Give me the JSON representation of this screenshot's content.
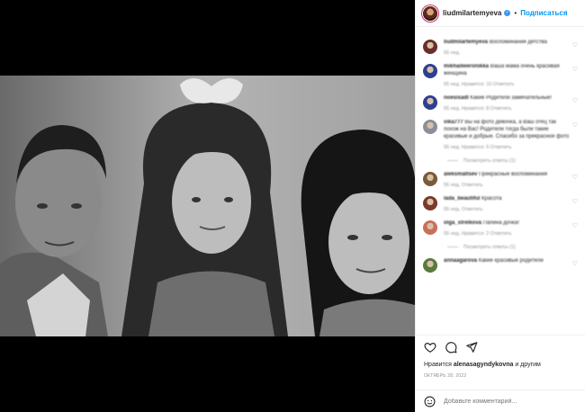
{
  "post": {
    "username": "liudmilartemyeva",
    "verified": true,
    "follow_label": "Подписаться",
    "separator": "•"
  },
  "comments": [
    {
      "user": "liudmilartemyeva",
      "text": "Воспоминания детства",
      "meta": "55 нед.",
      "avatar_color": "#6b2d2d",
      "replies": ""
    },
    {
      "user": "mikhailweronikka",
      "text": "Ваша мама очень красивая женщина",
      "meta": "55 нед.   Нравится: 10   Ответить",
      "avatar_color": "#2f3f8f",
      "replies": ""
    },
    {
      "user": "noesisadl",
      "text": "Какие Родители замечательные!",
      "meta": "55 нед.   Нравится: 8   Ответить",
      "avatar_color": "#2f3f8f",
      "replies": ""
    },
    {
      "user": "vika777",
      "text": "Вы на фото девочка, а Ваш отец так похож на Вас! Родители тогда были такие красивые и добрые. Спасибо за прекрасное фото",
      "meta": "55 нед.   Нравится: 6   Ответить",
      "avatar_color": "#8a8f9a",
      "replies": "Посмотреть ответы (1)"
    },
    {
      "user": "aleksmaltsev",
      "text": "Прекрасные воспоминания",
      "meta": "55 нед.   Ответить",
      "avatar_color": "#7a5a3a",
      "replies": ""
    },
    {
      "user": "lada_beautiful",
      "text": "Красота",
      "meta": "55 нед.   Ответить",
      "avatar_color": "#7a3a2a",
      "replies": ""
    },
    {
      "user": "olga_strelkova",
      "text": "Папина дочка!",
      "meta": "55 нед.   Нравится: 2   Ответить",
      "avatar_color": "#c9705a",
      "replies": "Посмотреть ответы (1)"
    },
    {
      "user": "annaagarova",
      "text": "Какие красивые родители",
      "meta": "",
      "avatar_color": "#5a7a3a",
      "replies": ""
    }
  ],
  "actions": {
    "like_icon": "heart-icon",
    "comment_icon": "comment-icon",
    "share_icon": "share-icon"
  },
  "likes": {
    "prefix": "Нравится",
    "user": "alenasagyndykovna",
    "suffix": "и другим"
  },
  "date": "ОКТЯБРЬ 28, 2022",
  "add_comment": {
    "placeholder": "Добавьте комментарий..."
  },
  "colors": {
    "accent": "#0095f6",
    "verified": "#3897f0",
    "text": "#262626",
    "muted": "#8e8e8e"
  }
}
